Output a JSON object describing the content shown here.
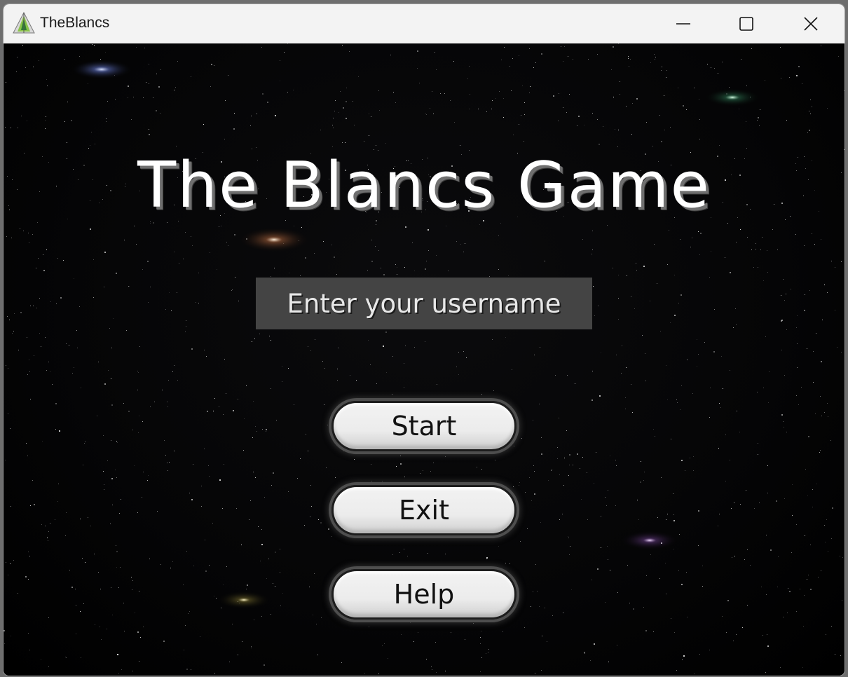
{
  "window": {
    "title": "TheBlancs",
    "controls": {
      "minimize_icon": "minimize-icon",
      "maximize_icon": "maximize-icon",
      "close_icon": "close-icon"
    }
  },
  "game": {
    "title": "The Blancs Game",
    "username_placeholder": "Enter your username",
    "username_value": "",
    "buttons": {
      "start": "Start",
      "exit": "Exit",
      "help": "Help"
    }
  },
  "colors": {
    "background": "#000000",
    "input_background": "#444444",
    "button_face": "#efefef",
    "title_text": "#ffffff"
  }
}
